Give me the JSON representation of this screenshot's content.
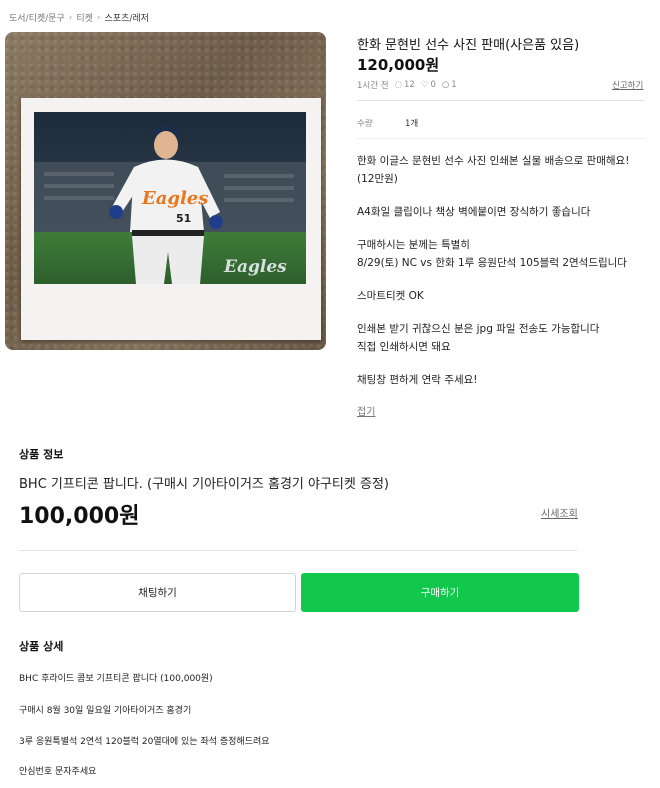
{
  "breadcrumb": [
    "도서/티켓/문구",
    "티켓",
    "스포츠/레저"
  ],
  "product": {
    "title": "한화 문현빈 선수 사진 판매(사은품 있음)",
    "price": "120,000원",
    "time_ago": "1시간 전",
    "views": "12",
    "likes": "0",
    "chats": "1",
    "report_label": "신고하기",
    "quantity_label": "수량",
    "quantity_value": "1개",
    "description": [
      "한화 이글스 문현빈 선수 사진 인쇄본 실물 배송으로 판매해요!\n(12만원)",
      "A4화일 클립이나 책상 벽에붙이면 장식하기 좋습니다",
      "구매하시는 분께는 특별히\n8/29(토) NC vs 한화 1루 응원단석 105블럭 2연석드립니다",
      "스마트티켓 OK",
      "인쇄본 받기 귀찮으신 분은 jpg 파일 전송도 가능합니다\n직접 인쇄하시면 돼요",
      "채팅창 편하게 연락 주세요!"
    ],
    "fold_label": "접기",
    "photo_texts": {
      "jersey_text": "Eagles",
      "jersey_number": "51",
      "watermark": "Eagles"
    }
  },
  "info_section": {
    "heading": "상품 정보",
    "title": "BHC 기프티콘 팝니다. (구매시 기아타이거즈 홈경기 야구티켓 증정)",
    "price": "100,000원",
    "market_label": "시세조회"
  },
  "buttons": {
    "chat": "채팅하기",
    "buy": "구매하기"
  },
  "detail_section": {
    "heading": "상품 상세",
    "lines": [
      "BHC 후라이드 콤보 기프티콘 팝니다 (100,000원)",
      "구매시 8월 30일 일요일 기아타이거즈 홈경기",
      "3루 응원특별석 2연석 120블럭 20열대에 있는 좌석 증정해드려요",
      "안심번호 문자주세요"
    ]
  },
  "colors": {
    "buy_button": "#12c84c",
    "photo_background": "#7a6852"
  }
}
